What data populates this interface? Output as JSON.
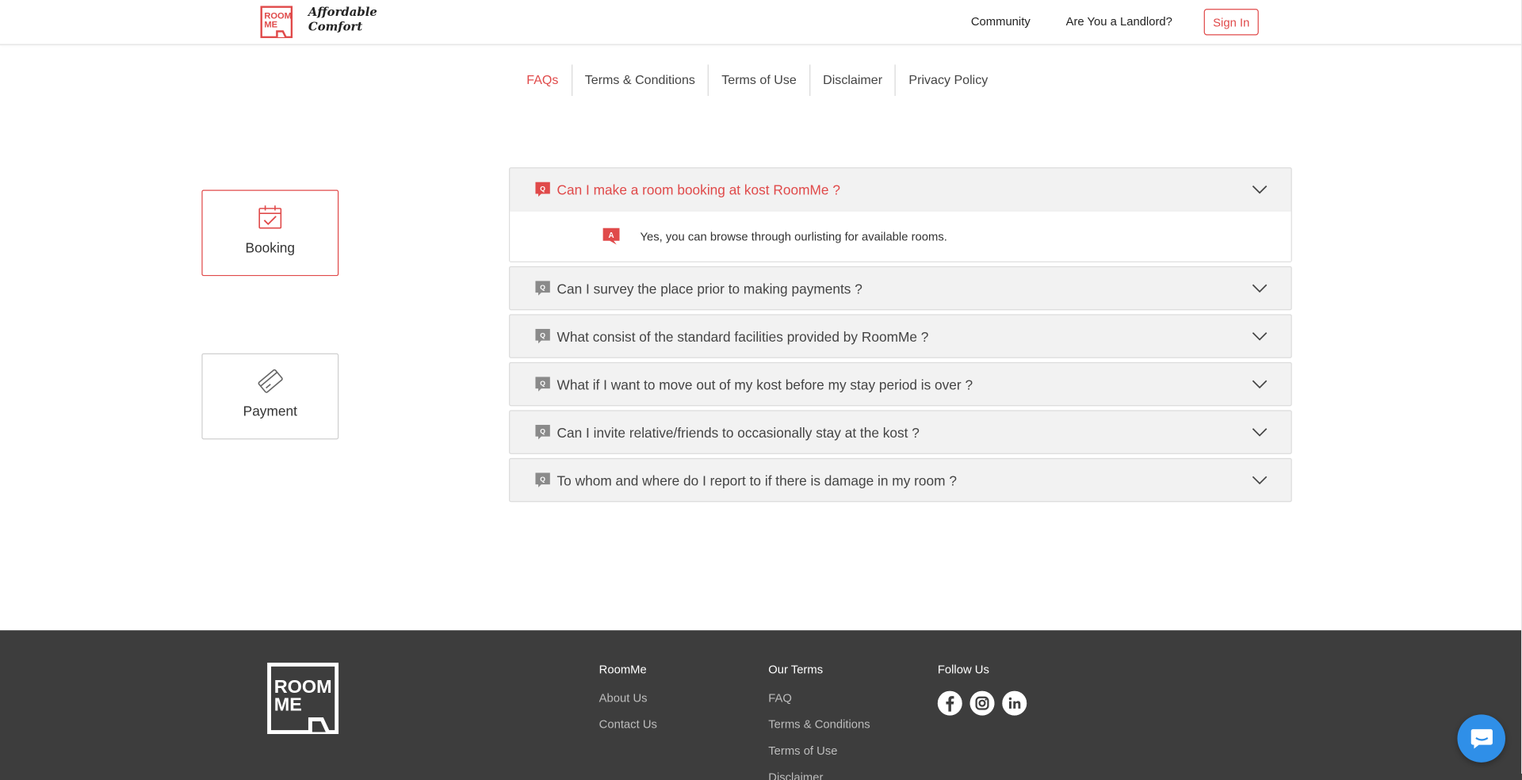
{
  "brand": {
    "logo_text_top": "ROOM",
    "logo_text_bottom": "ME",
    "tagline_line1": "Affordable",
    "tagline_line2": "Comfort",
    "accent_color": "#e04a4a"
  },
  "header": {
    "nav": [
      "Community",
      "Are You a Landlord?"
    ],
    "signin_label": "Sign In"
  },
  "tabs": [
    {
      "label": "FAQs",
      "active": true
    },
    {
      "label": "Terms & Conditions",
      "active": false
    },
    {
      "label": "Terms of Use",
      "active": false
    },
    {
      "label": "Disclaimer",
      "active": false
    },
    {
      "label": "Privacy Policy",
      "active": false
    }
  ],
  "categories": [
    {
      "label": "Booking",
      "icon": "calendar-check-icon",
      "active": true
    },
    {
      "label": "Payment",
      "icon": "credit-card-icon",
      "active": false
    }
  ],
  "faqs": [
    {
      "question": "Can I make a room booking at kost RoomMe ?",
      "answer": "Yes, you can browse through ourlisting for available rooms.",
      "open": true
    },
    {
      "question": "Can I survey the place prior to making payments ?",
      "open": false
    },
    {
      "question": "What consist of the standard facilities provided by RoomMe ?",
      "open": false
    },
    {
      "question": "What if I want to move out of my kost before my stay period is over ?",
      "open": false
    },
    {
      "question": "Can I invite relative/friends to occasionally stay at the kost ?",
      "open": false
    },
    {
      "question": "To whom and where do I report to if there is damage in my room ?",
      "open": false
    }
  ],
  "faq_badges": {
    "question": "Q",
    "answer": "A"
  },
  "footer": {
    "logo_text_top": "ROOM",
    "logo_text_bottom": "ME",
    "columns": [
      {
        "heading": "RoomMe",
        "links": [
          "About Us",
          "Contact Us"
        ]
      },
      {
        "heading": "Our Terms",
        "links": [
          "FAQ",
          "Terms & Conditions",
          "Terms of Use",
          "Disclaimer"
        ]
      },
      {
        "heading": "Follow Us",
        "social": [
          "facebook-icon",
          "instagram-icon",
          "linkedin-icon"
        ]
      }
    ]
  },
  "chat": {
    "icon": "chat-icon",
    "color": "#2f8fe8"
  }
}
